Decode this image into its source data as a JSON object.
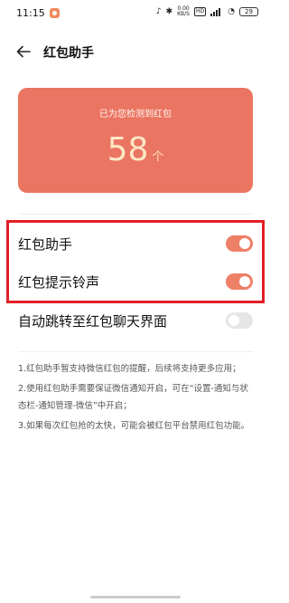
{
  "status_bar": {
    "time": "11:15",
    "net_speed_value": "0.00",
    "net_speed_unit": "KB/S",
    "hd_label": "HD",
    "battery": "29"
  },
  "header": {
    "title": "红包助手"
  },
  "card": {
    "text": "已为您检测到红包",
    "count": "58",
    "unit": "个"
  },
  "settings": [
    {
      "label": "红包助手",
      "enabled": true
    },
    {
      "label": "红包提示铃声",
      "enabled": true
    },
    {
      "label": "自动跳转至红包聊天界面",
      "enabled": false
    }
  ],
  "notes": [
    "1.红包助手暂支持微信红包的提醒，后续将支持更多应用；",
    "2.使用红包助手需要保证微信通知开启，可在“设置-通知与状态栏-通知管理-微信”中开启；",
    "3.如果每次红包抢的太快，可能会被红包平台禁用红包功能。"
  ],
  "colors": {
    "card": "#ea7562",
    "toggle_on": "#ee8068",
    "highlight": "#e01f26"
  }
}
